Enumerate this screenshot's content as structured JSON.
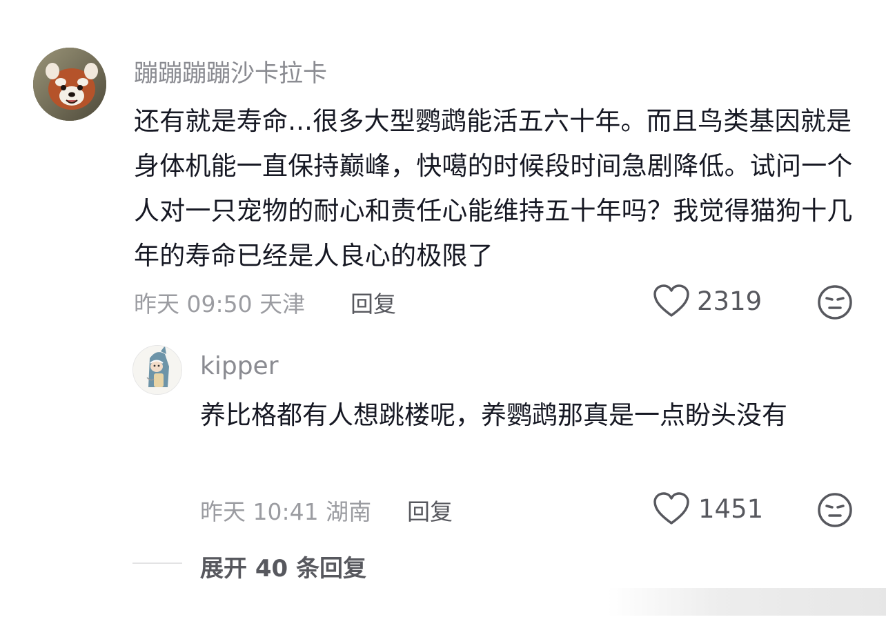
{
  "comment": {
    "username": "蹦蹦蹦蹦沙卡拉卡",
    "text": "还有就是寿命...很多大型鹦鹉能活五六十年。而且鸟类基因就是身体机能一直保持巅峰，快噶的时候段时间急剧降低。试问一个人对一只宠物的耐心和责任心能维持五十年吗？我觉得猫狗十几年的寿命已经是人良心的极限了",
    "meta": "昨天 09:50 天津",
    "reply_label": "回复",
    "likes": "2319",
    "avatar_icon": "red-panda-avatar",
    "like_icon": "heart-outline-icon",
    "reaction_icon": "meh-face-icon"
  },
  "reply": {
    "username": "kipper",
    "text": "养比格都有人想跳楼呢，养鹦鹉那真是一点盼头没有",
    "meta": "昨天 10:41 湖南",
    "reply_label": "回复",
    "likes": "1451",
    "avatar_icon": "shark-costume-avatar",
    "like_icon": "heart-outline-icon",
    "reaction_icon": "meh-face-icon"
  },
  "expand": {
    "label": "展开 40 条回复"
  },
  "colors": {
    "primary_text": "#161823",
    "secondary_text": "#8a8b91",
    "icon": "#57585e"
  }
}
